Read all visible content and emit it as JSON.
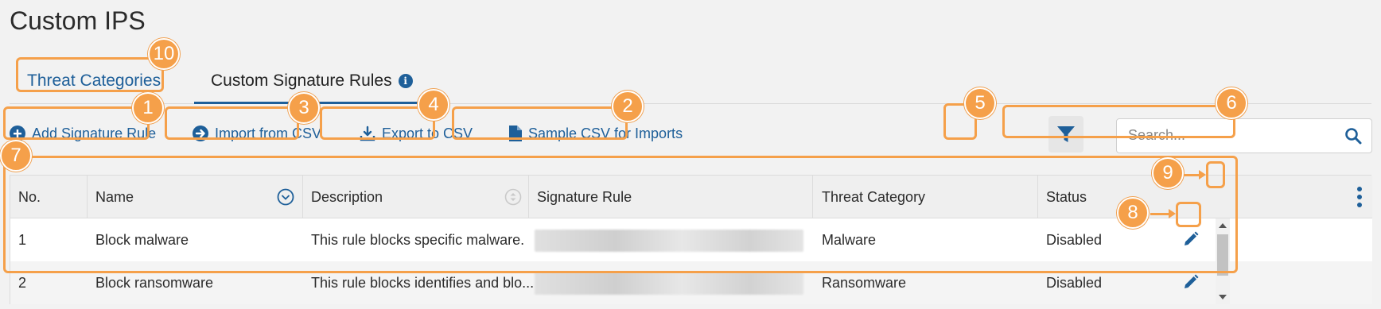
{
  "page": {
    "title": "Custom IPS"
  },
  "tabs": [
    {
      "label": "Threat Categories",
      "active": false
    },
    {
      "label": "Custom Signature Rules",
      "active": true
    }
  ],
  "toolbar": {
    "add_label": "Add Signature Rule",
    "import_label": "Import from CSV",
    "export_label": "Export to CSV",
    "sample_label": "Sample CSV for Imports"
  },
  "search": {
    "placeholder": "Search..."
  },
  "table": {
    "columns": [
      "No.",
      "Name",
      "Description",
      "Signature Rule",
      "Threat Category",
      "Status"
    ],
    "rows": [
      {
        "no": "1",
        "name": "Block malware",
        "description": "This rule blocks specific malware.",
        "threat_category": "Malware",
        "status": "Disabled"
      },
      {
        "no": "2",
        "name": "Block ransomware",
        "description": "This rule blocks identifies and blo...",
        "threat_category": "Ransomware",
        "status": "Disabled"
      }
    ]
  },
  "annotations": [
    "1",
    "2",
    "3",
    "4",
    "5",
    "6",
    "7",
    "8",
    "9",
    "10"
  ],
  "colors": {
    "accent": "#1e5f99",
    "annotation": "#f5a04a"
  },
  "icons": [
    "info-icon",
    "plus-circle-icon",
    "arrow-right-circle-icon",
    "download-icon",
    "document-icon",
    "filter-icon",
    "search-icon",
    "chevron-down-circle-icon",
    "sort-icon",
    "edit-icon",
    "kebab-menu-icon"
  ]
}
